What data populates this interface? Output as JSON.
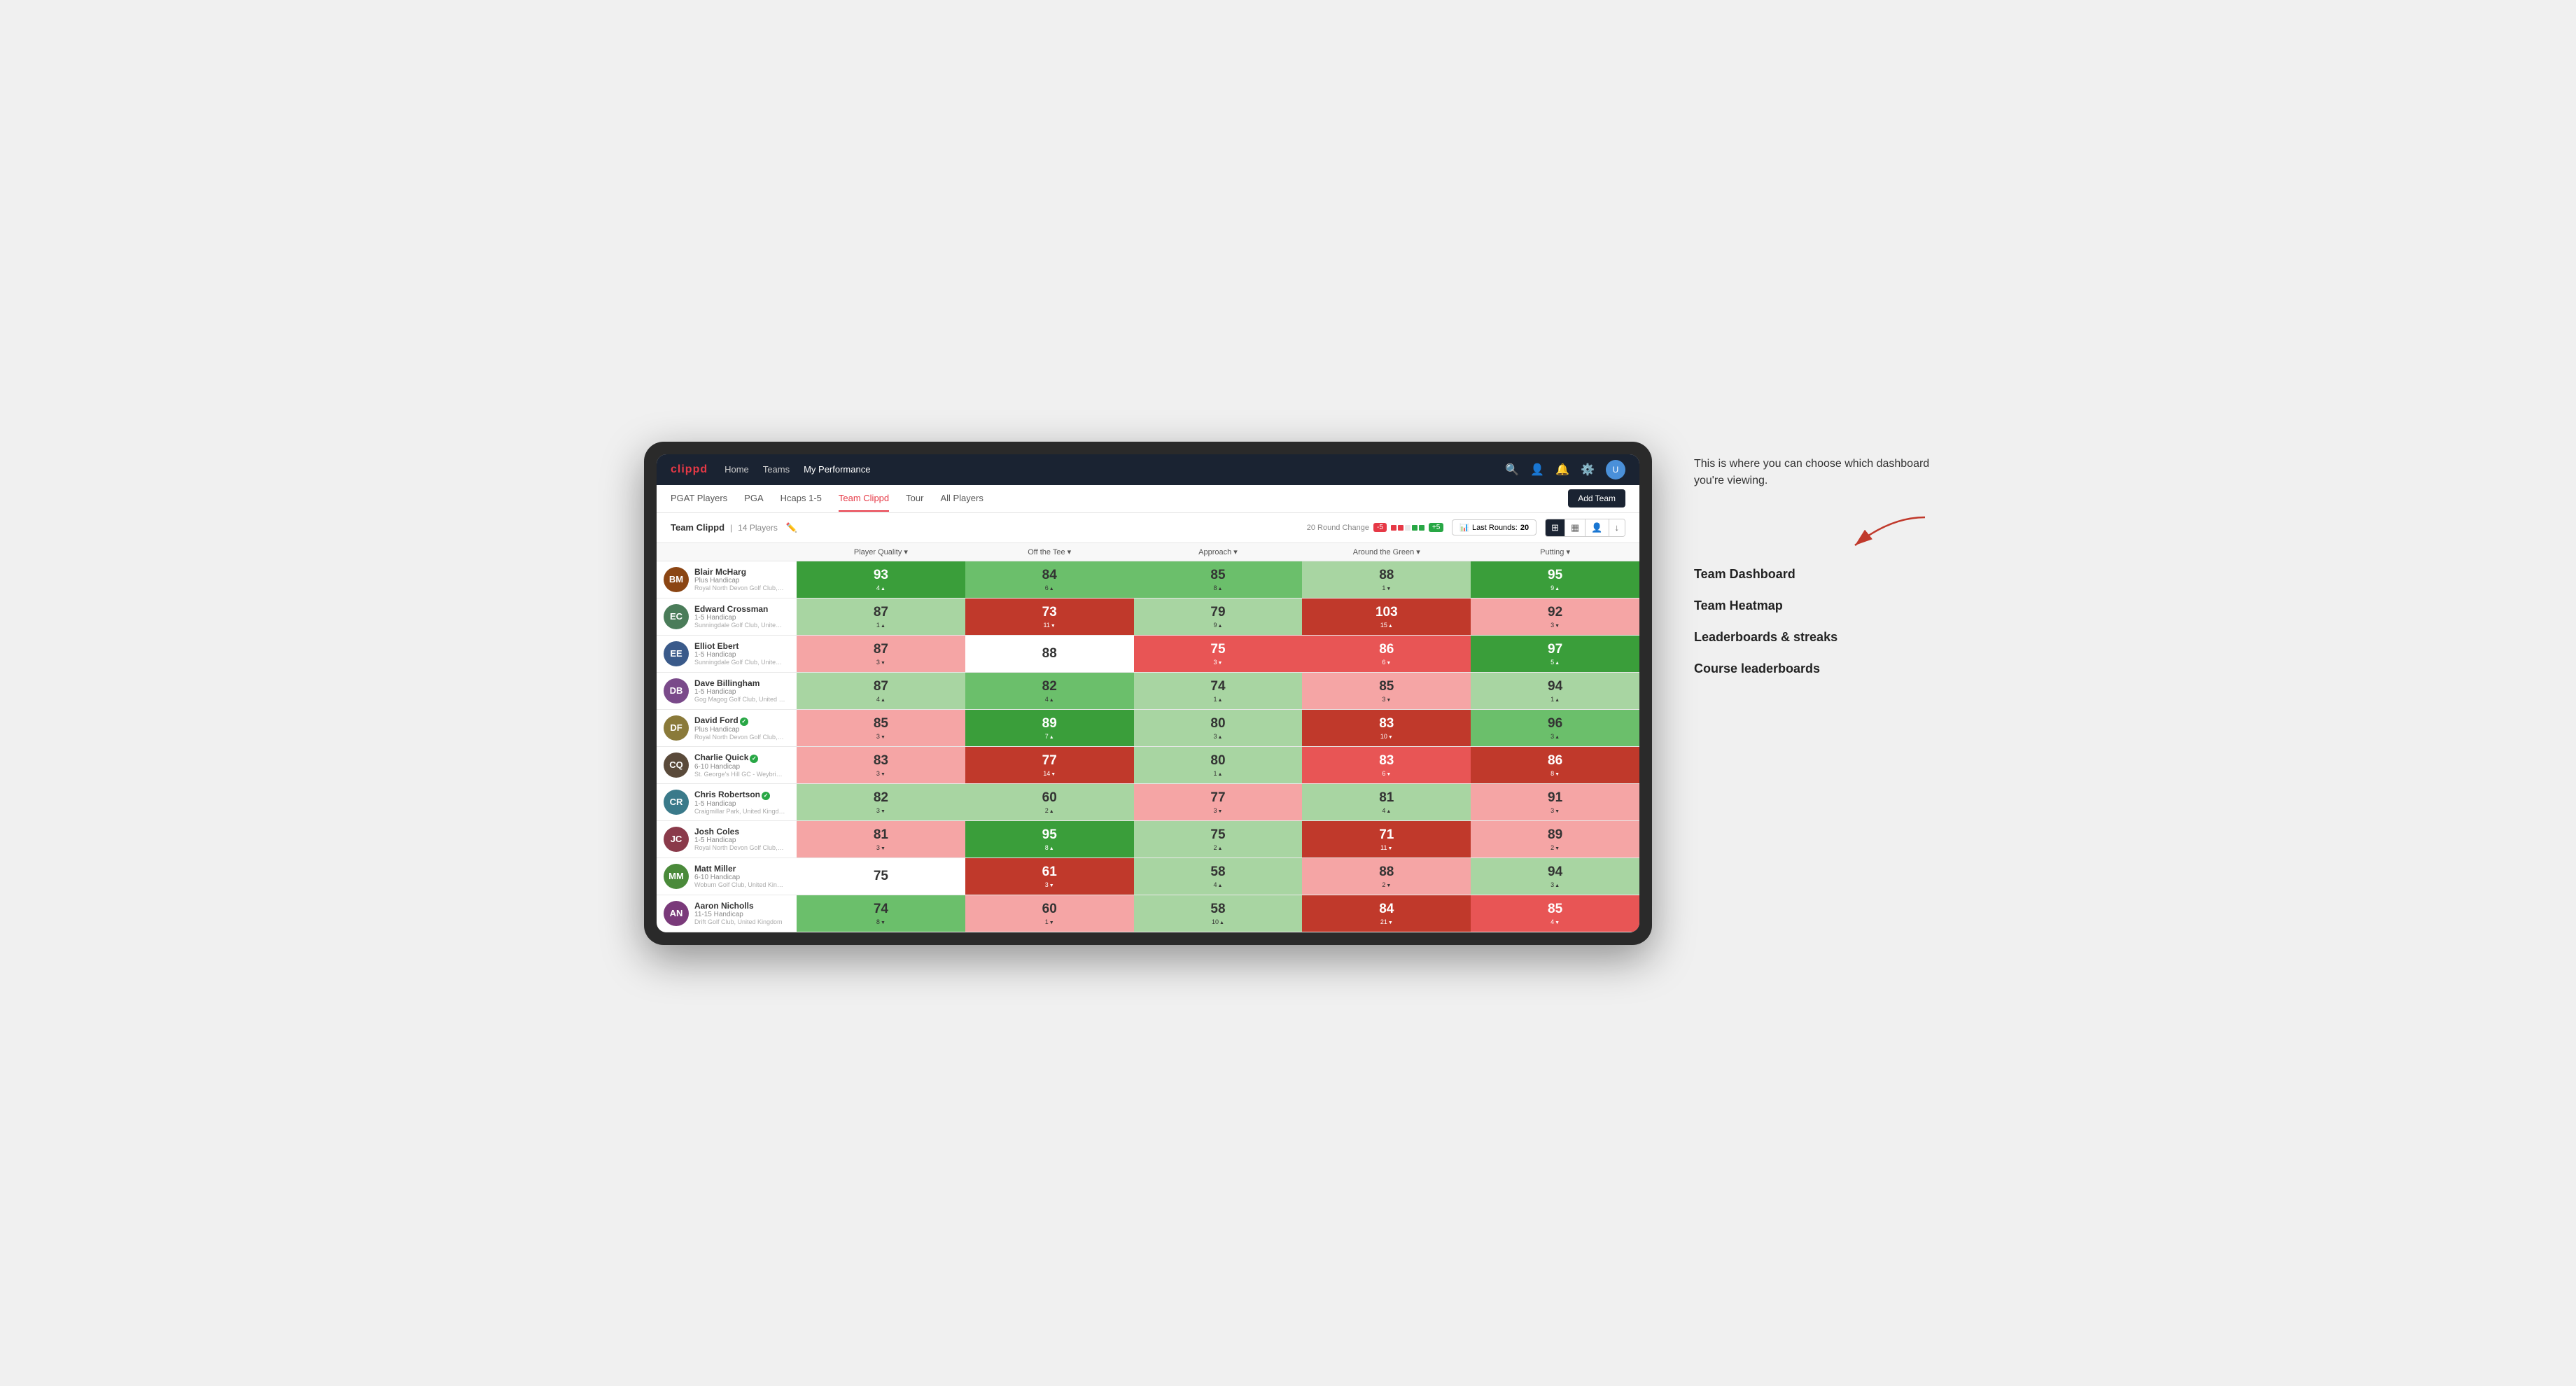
{
  "annotation": {
    "intro": "This is where you can choose which dashboard you're viewing.",
    "options": [
      "Team Dashboard",
      "Team Heatmap",
      "Leaderboards & streaks",
      "Course leaderboards"
    ]
  },
  "nav": {
    "logo": "clippd",
    "links": [
      "Home",
      "Teams",
      "My Performance"
    ],
    "active_link": "My Performance"
  },
  "sub_nav": {
    "items": [
      "PGAT Players",
      "PGA",
      "Hcaps 1-5",
      "Team Clippd",
      "Tour",
      "All Players"
    ],
    "active": "Team Clippd",
    "add_team": "Add Team"
  },
  "team_header": {
    "name": "Team Clippd",
    "separator": "|",
    "count": "14 Players",
    "round_change_label": "20 Round Change",
    "change_neg": "-5",
    "change_pos": "+5",
    "last_rounds_label": "Last Rounds:",
    "last_rounds_value": "20"
  },
  "table": {
    "columns": [
      "Player Quality ▾",
      "Off the Tee ▾",
      "Approach ▾",
      "Around the Green ▾",
      "Putting ▾"
    ],
    "players": [
      {
        "name": "Blair McHarg",
        "hcp": "Plus Handicap",
        "club": "Royal North Devon Golf Club, United Kingdom",
        "initials": "BM",
        "scores": [
          {
            "val": "93",
            "delta": "4",
            "dir": "up",
            "color": "green-dark"
          },
          {
            "val": "84",
            "delta": "6",
            "dir": "up",
            "color": "green-mid"
          },
          {
            "val": "85",
            "delta": "8",
            "dir": "up",
            "color": "green-mid"
          },
          {
            "val": "88",
            "delta": "1",
            "dir": "down",
            "color": "green-light"
          },
          {
            "val": "95",
            "delta": "9",
            "dir": "up",
            "color": "green-dark"
          }
        ]
      },
      {
        "name": "Edward Crossman",
        "hcp": "1-5 Handicap",
        "club": "Sunningdale Golf Club, United Kingdom",
        "initials": "EC",
        "scores": [
          {
            "val": "87",
            "delta": "1",
            "dir": "up",
            "color": "green-light"
          },
          {
            "val": "73",
            "delta": "11",
            "dir": "down",
            "color": "red-dark"
          },
          {
            "val": "79",
            "delta": "9",
            "dir": "up",
            "color": "green-light"
          },
          {
            "val": "103",
            "delta": "15",
            "dir": "up",
            "color": "red-dark"
          },
          {
            "val": "92",
            "delta": "3",
            "dir": "down",
            "color": "red-light"
          }
        ]
      },
      {
        "name": "Elliot Ebert",
        "hcp": "1-5 Handicap",
        "club": "Sunningdale Golf Club, United Kingdom",
        "initials": "EE",
        "scores": [
          {
            "val": "87",
            "delta": "3",
            "dir": "down",
            "color": "red-light"
          },
          {
            "val": "88",
            "delta": "",
            "dir": "",
            "color": "white"
          },
          {
            "val": "75",
            "delta": "3",
            "dir": "down",
            "color": "red-mid"
          },
          {
            "val": "86",
            "delta": "6",
            "dir": "down",
            "color": "red-mid"
          },
          {
            "val": "97",
            "delta": "5",
            "dir": "up",
            "color": "green-dark"
          }
        ]
      },
      {
        "name": "Dave Billingham",
        "hcp": "1-5 Handicap",
        "club": "Gog Magog Golf Club, United Kingdom",
        "initials": "DB",
        "scores": [
          {
            "val": "87",
            "delta": "4",
            "dir": "up",
            "color": "green-light"
          },
          {
            "val": "82",
            "delta": "4",
            "dir": "up",
            "color": "green-mid"
          },
          {
            "val": "74",
            "delta": "1",
            "dir": "up",
            "color": "green-light"
          },
          {
            "val": "85",
            "delta": "3",
            "dir": "down",
            "color": "red-light"
          },
          {
            "val": "94",
            "delta": "1",
            "dir": "up",
            "color": "green-light"
          }
        ]
      },
      {
        "name": "David Ford",
        "hcp": "Plus Handicap",
        "club": "Royal North Devon Golf Club, United Kingdom",
        "initials": "DF",
        "verified": true,
        "scores": [
          {
            "val": "85",
            "delta": "3",
            "dir": "down",
            "color": "red-light"
          },
          {
            "val": "89",
            "delta": "7",
            "dir": "up",
            "color": "green-dark"
          },
          {
            "val": "80",
            "delta": "3",
            "dir": "up",
            "color": "green-light"
          },
          {
            "val": "83",
            "delta": "10",
            "dir": "down",
            "color": "red-dark"
          },
          {
            "val": "96",
            "delta": "3",
            "dir": "up",
            "color": "green-mid"
          }
        ]
      },
      {
        "name": "Charlie Quick",
        "hcp": "6-10 Handicap",
        "club": "St. George's Hill GC - Weybridge, Surrey, Uni...",
        "initials": "CQ",
        "verified": true,
        "scores": [
          {
            "val": "83",
            "delta": "3",
            "dir": "down",
            "color": "red-light"
          },
          {
            "val": "77",
            "delta": "14",
            "dir": "down",
            "color": "red-dark"
          },
          {
            "val": "80",
            "delta": "1",
            "dir": "up",
            "color": "green-light"
          },
          {
            "val": "83",
            "delta": "6",
            "dir": "down",
            "color": "red-mid"
          },
          {
            "val": "86",
            "delta": "8",
            "dir": "down",
            "color": "red-dark"
          }
        ]
      },
      {
        "name": "Chris Robertson",
        "hcp": "1-5 Handicap",
        "club": "Craigmillar Park, United Kingdom",
        "initials": "CR",
        "verified": true,
        "scores": [
          {
            "val": "82",
            "delta": "3",
            "dir": "down",
            "color": "green-light"
          },
          {
            "val": "60",
            "delta": "2",
            "dir": "up",
            "color": "green-light"
          },
          {
            "val": "77",
            "delta": "3",
            "dir": "down",
            "color": "red-light"
          },
          {
            "val": "81",
            "delta": "4",
            "dir": "up",
            "color": "green-light"
          },
          {
            "val": "91",
            "delta": "3",
            "dir": "down",
            "color": "red-light"
          }
        ]
      },
      {
        "name": "Josh Coles",
        "hcp": "1-5 Handicap",
        "club": "Royal North Devon Golf Club, United Kingdom",
        "initials": "JC",
        "scores": [
          {
            "val": "81",
            "delta": "3",
            "dir": "down",
            "color": "red-light"
          },
          {
            "val": "95",
            "delta": "8",
            "dir": "up",
            "color": "green-dark"
          },
          {
            "val": "75",
            "delta": "2",
            "dir": "up",
            "color": "green-light"
          },
          {
            "val": "71",
            "delta": "11",
            "dir": "down",
            "color": "red-dark"
          },
          {
            "val": "89",
            "delta": "2",
            "dir": "down",
            "color": "red-light"
          }
        ]
      },
      {
        "name": "Matt Miller",
        "hcp": "6-10 Handicap",
        "club": "Woburn Golf Club, United Kingdom",
        "initials": "MM",
        "scores": [
          {
            "val": "75",
            "delta": "",
            "dir": "",
            "color": "white"
          },
          {
            "val": "61",
            "delta": "3",
            "dir": "down",
            "color": "red-dark"
          },
          {
            "val": "58",
            "delta": "4",
            "dir": "up",
            "color": "green-light"
          },
          {
            "val": "88",
            "delta": "2",
            "dir": "down",
            "color": "red-light"
          },
          {
            "val": "94",
            "delta": "3",
            "dir": "up",
            "color": "green-light"
          }
        ]
      },
      {
        "name": "Aaron Nicholls",
        "hcp": "11-15 Handicap",
        "club": "Drift Golf Club, United Kingdom",
        "initials": "AN",
        "scores": [
          {
            "val": "74",
            "delta": "8",
            "dir": "down",
            "color": "green-mid"
          },
          {
            "val": "60",
            "delta": "1",
            "dir": "down",
            "color": "red-light"
          },
          {
            "val": "58",
            "delta": "10",
            "dir": "up",
            "color": "green-light"
          },
          {
            "val": "84",
            "delta": "21",
            "dir": "down",
            "color": "red-dark"
          },
          {
            "val": "85",
            "delta": "4",
            "dir": "down",
            "color": "red-mid"
          }
        ]
      }
    ]
  }
}
